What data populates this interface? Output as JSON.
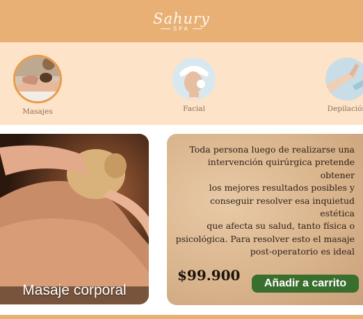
{
  "header": {
    "brand": "Sahury",
    "brand_sub": "SPA"
  },
  "categories": [
    {
      "label": "Masajes",
      "icon": "massage-photo",
      "active": true
    },
    {
      "label": "Facial",
      "icon": "facial-photo",
      "active": false
    },
    {
      "label": "Depilación",
      "icon": "depilation-photo",
      "active": false
    }
  ],
  "product": {
    "title": "Masaje corporal",
    "description_lines": [
      "Toda persona luego de realizarse una",
      "intervención quirúrgica pretende obtener",
      "los mejores resultados posibles y",
      "conseguir resolver esa inquietud estética",
      "que afecta su salud, tanto física o",
      "psicológica. Para resolver esto el masaje",
      "post-operatorio es ideal"
    ],
    "price": "$99.900",
    "add_to_cart": "Añadir a carrito"
  },
  "colors": {
    "header_bg": "#e8b074",
    "category_bg": "#fde3c7",
    "button_bg": "#3a6e2e",
    "active_ring": "#e79b4a"
  }
}
